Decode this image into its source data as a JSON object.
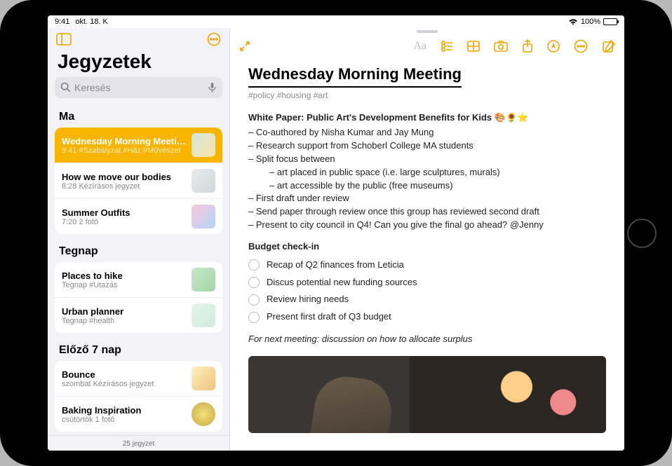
{
  "status": {
    "time": "9:41",
    "date": "okt. 18. K",
    "wifi": true,
    "battery_pct": "100%"
  },
  "sidebar": {
    "title": "Jegyzetek",
    "search_placeholder": "Keresés",
    "footer": "25 jegyzet",
    "sections": [
      {
        "header": "Ma",
        "notes": [
          {
            "title": "Wednesday Morning Meeting",
            "sub": "9:41  #Szabályzat #Ház #Művészet",
            "selected": true,
            "thumb": "t1"
          },
          {
            "title": "How we move our bodies",
            "sub": "8:28  Kézírásos jegyzet",
            "thumb": "t2"
          },
          {
            "title": "Summer Outfits",
            "sub": "7:20  2 fotó",
            "thumb": "t3"
          }
        ]
      },
      {
        "header": "Tegnap",
        "notes": [
          {
            "title": "Places to hike",
            "sub": "Tegnap  #Utazás",
            "thumb": "t4"
          },
          {
            "title": "Urban planner",
            "sub": "Tegnap  #health",
            "thumb": "t5"
          }
        ]
      },
      {
        "header": "Előző 7 nap",
        "notes": [
          {
            "title": "Bounce",
            "sub": "szombat  Kézírásos jegyzet",
            "thumb": "t6"
          },
          {
            "title": "Baking Inspiration",
            "sub": "csütörtök  1 fotó",
            "thumb": "t7"
          }
        ]
      }
    ]
  },
  "note": {
    "title": "Wednesday Morning Meeting",
    "tags": "#policy #housing #art",
    "subhead": "White Paper: Public Art's Development Benefits for Kids 🎨🌻⭐",
    "bullets": [
      "– Co-authored by Nisha Kumar and Jay Mung",
      "– Research support from Schoberl College MA students",
      "– Split focus between",
      "– art placed in public space (i.e. large sculptures, murals)",
      "– art accessible by the public (free museums)",
      "– First draft under review",
      "– Send paper through review once this group has reviewed second draft",
      "– Present to city council in Q4! Can you give the final go ahead? @Jenny"
    ],
    "section2_title": "Budget check-in",
    "checks": [
      "Recap of Q2 finances from Leticia",
      "Discus potential new funding sources",
      "Review hiring needs",
      "Present first draft of Q3 budget"
    ],
    "footnote": "For next meeting: discussion on how to allocate surplus"
  }
}
